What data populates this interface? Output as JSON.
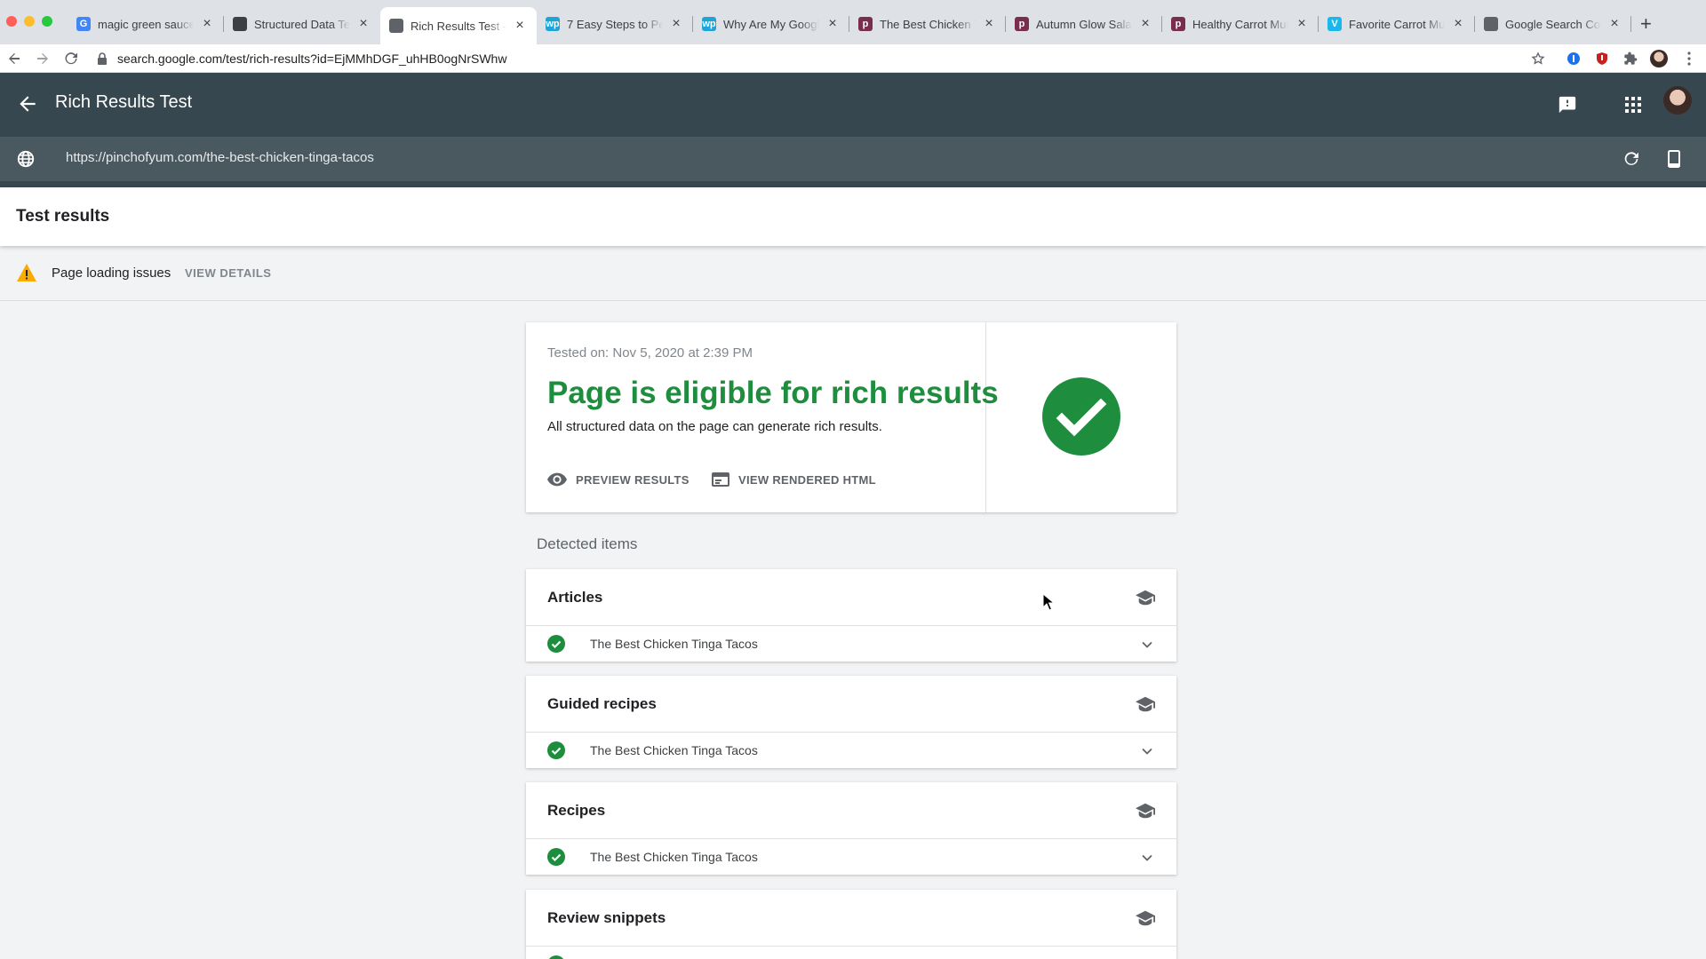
{
  "browser": {
    "tabs": [
      {
        "title": "magic green sauce",
        "favicon": "google-icon",
        "color": "#4285f4",
        "glyph": "G"
      },
      {
        "title": "Structured Data Testing Tool",
        "favicon": "globe-icon",
        "color": "#3c4043",
        "glyph": ""
      },
      {
        "title": "Rich Results Test - Google",
        "favicon": "rich-results-icon",
        "color": "#5f6368",
        "glyph": ""
      },
      {
        "title": "7 Easy Steps to Perfect",
        "favicon": "wp-icon",
        "color": "#1ea5d8",
        "glyph": "wp"
      },
      {
        "title": "Why Are My Google Rich",
        "favicon": "wp-icon",
        "color": "#1ea5d8",
        "glyph": "wp"
      },
      {
        "title": "The Best Chicken Tinga",
        "favicon": "pinch-of-yum-icon",
        "color": "#7a2e4d",
        "glyph": "p"
      },
      {
        "title": "Autumn Glow Salad",
        "favicon": "pinch-of-yum-icon",
        "color": "#7a2e4d",
        "glyph": "p"
      },
      {
        "title": "Healthy Carrot Muffins",
        "favicon": "pinch-of-yum-icon",
        "color": "#7a2e4d",
        "glyph": "p"
      },
      {
        "title": "Favorite Carrot Muffins",
        "favicon": "vimeo-icon",
        "color": "#1ab7ea",
        "glyph": "V"
      },
      {
        "title": "Google Search Console",
        "favicon": "search-console-icon",
        "color": "#5f6368",
        "glyph": ""
      }
    ],
    "active_tab_index": 2,
    "address": "search.google.com/test/rich-results?id=EjMMhDGF_uhHB0ogNrSWhw"
  },
  "app": {
    "title": "Rich Results Test",
    "tested_url": "https://pinchofyum.com/the-best-chicken-tinga-tacos"
  },
  "results": {
    "title": "Test results",
    "warning_text": "Page loading issues",
    "warning_link": "VIEW DETAILS"
  },
  "summary": {
    "tested_on": "Tested on: Nov 5, 2020 at 2:39 PM",
    "heading": "Page is eligible for rich results",
    "description": "All structured data on the page can generate rich results.",
    "preview_label": "PREVIEW RESULTS",
    "html_label": "VIEW RENDERED HTML"
  },
  "detected": {
    "label": "Detected items",
    "items": [
      {
        "title": "Articles",
        "entry": "The Best Chicken Tinga Tacos"
      },
      {
        "title": "Guided recipes",
        "entry": "The Best Chicken Tinga Tacos"
      },
      {
        "title": "Recipes",
        "entry": "The Best Chicken Tinga Tacos"
      },
      {
        "title": "Review snippets",
        "entry": ""
      }
    ]
  },
  "colors": {
    "header": "#37474f",
    "url_bar": "#4a5960",
    "success_green": "#1e8e3e",
    "warning_amber": "#f9ab00"
  }
}
